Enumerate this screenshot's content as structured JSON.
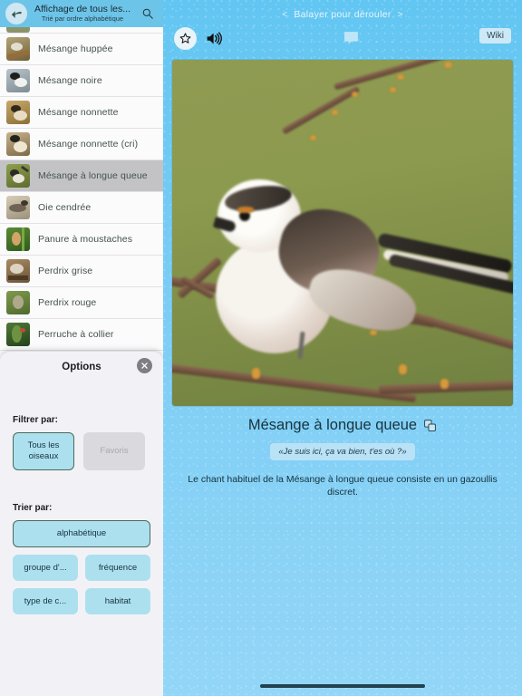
{
  "sidebar": {
    "header": {
      "back_icon": "back-arrow-icon",
      "title": "Affichage de tous les...",
      "subtitle": "Trié par ordre alphabétique",
      "search_icon": "search-icon"
    },
    "birds": [
      {
        "name": "Mésange huppée"
      },
      {
        "name": "Mésange noire"
      },
      {
        "name": "Mésange nonnette"
      },
      {
        "name": "Mésange nonnette (cri)"
      },
      {
        "name": "Mésange à longue queue",
        "selected": true
      },
      {
        "name": "Oie cendrée"
      },
      {
        "name": "Panure à moustaches"
      },
      {
        "name": "Perdrix grise"
      },
      {
        "name": "Perdrix rouge"
      },
      {
        "name": "Perruche à collier"
      }
    ]
  },
  "options": {
    "title": "Options",
    "close_icon": "close-icon",
    "filter_label": "Filtrer par:",
    "filter_buttons": [
      {
        "label": "Tous les oiseaux",
        "state": "selected"
      },
      {
        "label": "Favoris",
        "state": "disabled"
      }
    ],
    "sort_label": "Trier par:",
    "sort_primary": {
      "label": "alphabétique",
      "state": "selected"
    },
    "sort_buttons": [
      {
        "label": "groupe d'..."
      },
      {
        "label": "fréquence"
      },
      {
        "label": "type de c..."
      },
      {
        "label": "habitat"
      }
    ]
  },
  "main": {
    "swipe_hint": "Balayer pour dérouler",
    "chevron_left": "<",
    "chevron_right": ">",
    "favorite_icon": "star-outline-icon",
    "sound_icon": "speaker-icon",
    "comment_icon": "speech-bubble-icon",
    "wiki_label": "Wiki",
    "photo_alt": "long-tailed-tit-on-branch-photo",
    "bird_title": "Mésange à longue queue",
    "title_icon": "compare-cards-icon",
    "quote": "«Je suis ici, ça va bien, t'es où ?»",
    "description": "Le chant habituel de la Mésange à longue queue consiste en un gazoullis discret."
  },
  "colors": {
    "header_blue": "#6cc5e8",
    "accent_blue": "#ade0ef",
    "selected_border": "#4b6b5c",
    "background_blue": "#7ccdf5",
    "sidebar_bg": "#f2f2f6"
  }
}
